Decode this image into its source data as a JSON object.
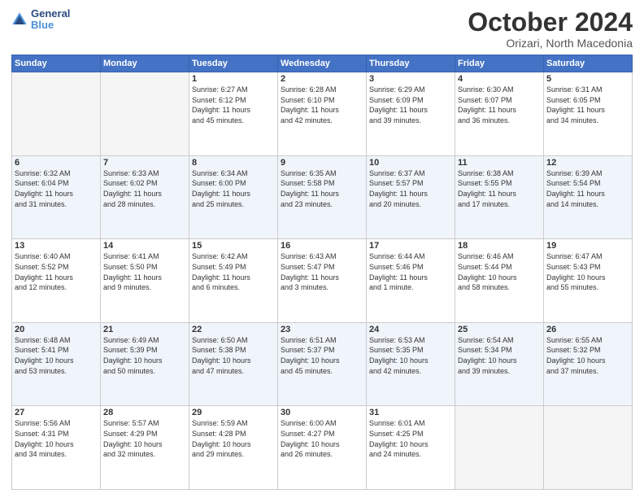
{
  "header": {
    "logo_line1": "General",
    "logo_line2": "Blue",
    "month_title": "October 2024",
    "subtitle": "Orizari, North Macedonia"
  },
  "weekdays": [
    "Sunday",
    "Monday",
    "Tuesday",
    "Wednesday",
    "Thursday",
    "Friday",
    "Saturday"
  ],
  "rows": [
    [
      {
        "num": "",
        "info": ""
      },
      {
        "num": "",
        "info": ""
      },
      {
        "num": "1",
        "info": "Sunrise: 6:27 AM\nSunset: 6:12 PM\nDaylight: 11 hours\nand 45 minutes."
      },
      {
        "num": "2",
        "info": "Sunrise: 6:28 AM\nSunset: 6:10 PM\nDaylight: 11 hours\nand 42 minutes."
      },
      {
        "num": "3",
        "info": "Sunrise: 6:29 AM\nSunset: 6:09 PM\nDaylight: 11 hours\nand 39 minutes."
      },
      {
        "num": "4",
        "info": "Sunrise: 6:30 AM\nSunset: 6:07 PM\nDaylight: 11 hours\nand 36 minutes."
      },
      {
        "num": "5",
        "info": "Sunrise: 6:31 AM\nSunset: 6:05 PM\nDaylight: 11 hours\nand 34 minutes."
      }
    ],
    [
      {
        "num": "6",
        "info": "Sunrise: 6:32 AM\nSunset: 6:04 PM\nDaylight: 11 hours\nand 31 minutes."
      },
      {
        "num": "7",
        "info": "Sunrise: 6:33 AM\nSunset: 6:02 PM\nDaylight: 11 hours\nand 28 minutes."
      },
      {
        "num": "8",
        "info": "Sunrise: 6:34 AM\nSunset: 6:00 PM\nDaylight: 11 hours\nand 25 minutes."
      },
      {
        "num": "9",
        "info": "Sunrise: 6:35 AM\nSunset: 5:58 PM\nDaylight: 11 hours\nand 23 minutes."
      },
      {
        "num": "10",
        "info": "Sunrise: 6:37 AM\nSunset: 5:57 PM\nDaylight: 11 hours\nand 20 minutes."
      },
      {
        "num": "11",
        "info": "Sunrise: 6:38 AM\nSunset: 5:55 PM\nDaylight: 11 hours\nand 17 minutes."
      },
      {
        "num": "12",
        "info": "Sunrise: 6:39 AM\nSunset: 5:54 PM\nDaylight: 11 hours\nand 14 minutes."
      }
    ],
    [
      {
        "num": "13",
        "info": "Sunrise: 6:40 AM\nSunset: 5:52 PM\nDaylight: 11 hours\nand 12 minutes."
      },
      {
        "num": "14",
        "info": "Sunrise: 6:41 AM\nSunset: 5:50 PM\nDaylight: 11 hours\nand 9 minutes."
      },
      {
        "num": "15",
        "info": "Sunrise: 6:42 AM\nSunset: 5:49 PM\nDaylight: 11 hours\nand 6 minutes."
      },
      {
        "num": "16",
        "info": "Sunrise: 6:43 AM\nSunset: 5:47 PM\nDaylight: 11 hours\nand 3 minutes."
      },
      {
        "num": "17",
        "info": "Sunrise: 6:44 AM\nSunset: 5:46 PM\nDaylight: 11 hours\nand 1 minute."
      },
      {
        "num": "18",
        "info": "Sunrise: 6:46 AM\nSunset: 5:44 PM\nDaylight: 10 hours\nand 58 minutes."
      },
      {
        "num": "19",
        "info": "Sunrise: 6:47 AM\nSunset: 5:43 PM\nDaylight: 10 hours\nand 55 minutes."
      }
    ],
    [
      {
        "num": "20",
        "info": "Sunrise: 6:48 AM\nSunset: 5:41 PM\nDaylight: 10 hours\nand 53 minutes."
      },
      {
        "num": "21",
        "info": "Sunrise: 6:49 AM\nSunset: 5:39 PM\nDaylight: 10 hours\nand 50 minutes."
      },
      {
        "num": "22",
        "info": "Sunrise: 6:50 AM\nSunset: 5:38 PM\nDaylight: 10 hours\nand 47 minutes."
      },
      {
        "num": "23",
        "info": "Sunrise: 6:51 AM\nSunset: 5:37 PM\nDaylight: 10 hours\nand 45 minutes."
      },
      {
        "num": "24",
        "info": "Sunrise: 6:53 AM\nSunset: 5:35 PM\nDaylight: 10 hours\nand 42 minutes."
      },
      {
        "num": "25",
        "info": "Sunrise: 6:54 AM\nSunset: 5:34 PM\nDaylight: 10 hours\nand 39 minutes."
      },
      {
        "num": "26",
        "info": "Sunrise: 6:55 AM\nSunset: 5:32 PM\nDaylight: 10 hours\nand 37 minutes."
      }
    ],
    [
      {
        "num": "27",
        "info": "Sunrise: 5:56 AM\nSunset: 4:31 PM\nDaylight: 10 hours\nand 34 minutes."
      },
      {
        "num": "28",
        "info": "Sunrise: 5:57 AM\nSunset: 4:29 PM\nDaylight: 10 hours\nand 32 minutes."
      },
      {
        "num": "29",
        "info": "Sunrise: 5:59 AM\nSunset: 4:28 PM\nDaylight: 10 hours\nand 29 minutes."
      },
      {
        "num": "30",
        "info": "Sunrise: 6:00 AM\nSunset: 4:27 PM\nDaylight: 10 hours\nand 26 minutes."
      },
      {
        "num": "31",
        "info": "Sunrise: 6:01 AM\nSunset: 4:25 PM\nDaylight: 10 hours\nand 24 minutes."
      },
      {
        "num": "",
        "info": ""
      },
      {
        "num": "",
        "info": ""
      }
    ]
  ]
}
